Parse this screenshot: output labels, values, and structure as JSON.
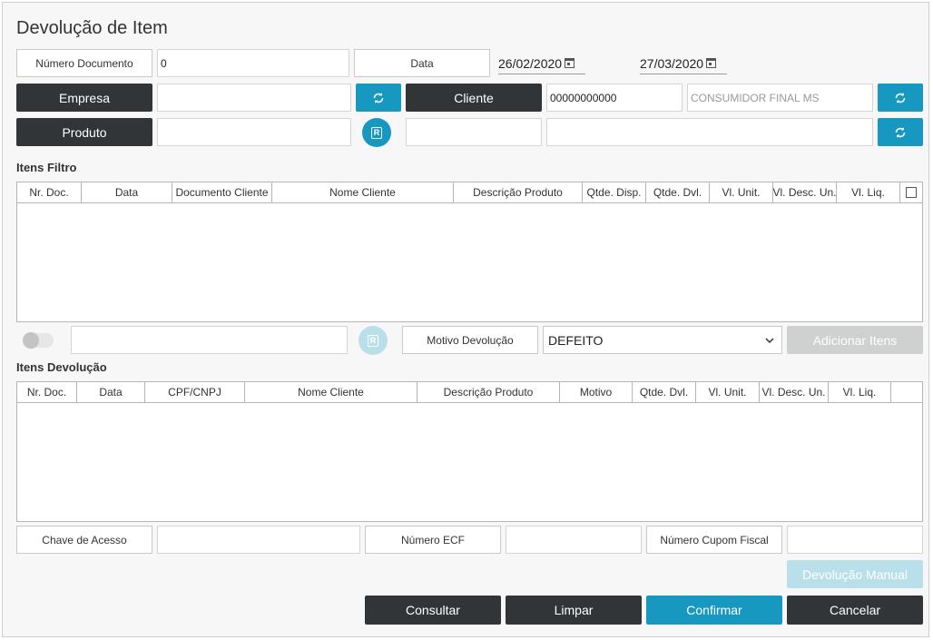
{
  "title": "Devolução de Item",
  "header": {
    "numero_documento_label": "Número Documento",
    "numero_documento_value": "0",
    "data_label": "Data",
    "date_from": "26/02/2020",
    "date_to": "27/03/2020",
    "empresa_label": "Empresa",
    "empresa_value": "",
    "cliente_label": "Cliente",
    "cliente_code": "00000000000",
    "cliente_name": "CONSUMIDOR FINAL MS",
    "produto_label": "Produto",
    "produto_value": "",
    "produto_code": "",
    "produto_desc": "",
    "r_badge": "R"
  },
  "itens_filtro": {
    "title": "Itens Filtro",
    "columns": [
      "Nr. Doc.",
      "Data",
      "Documento Cliente",
      "Nome Cliente",
      "Descrição Produto",
      "Qtde. Disp.",
      "Qtde. Dvl.",
      "Vl. Unit.",
      "Vl. Desc. Un.",
      "Vl. Liq."
    ],
    "rows": []
  },
  "mid": {
    "scan_value": "",
    "motivo_label": "Motivo Devolução",
    "motivo_value": "DEFEITO",
    "adicionar_label": "Adicionar Itens"
  },
  "itens_devolucao": {
    "title": "Itens Devolução",
    "columns": [
      "Nr. Doc.",
      "Data",
      "CPF/CNPJ",
      "Nome Cliente",
      "Descrição Produto",
      "Motivo",
      "Qtde. Dvl.",
      "Vl. Unit.",
      "Vl. Desc. Un.",
      "Vl. Liq."
    ],
    "rows": []
  },
  "bottom": {
    "chave_label": "Chave de Acesso",
    "chave_value": "",
    "ecf_label": "Número ECF",
    "ecf_value": "",
    "cupom_label": "Número Cupom Fiscal",
    "cupom_value": "",
    "devolucao_manual_label": "Devolução Manual"
  },
  "actions": {
    "consultar": "Consultar",
    "limpar": "Limpar",
    "confirmar": "Confirmar",
    "cancelar": "Cancelar"
  },
  "colors": {
    "dark_button": "#323537",
    "accent_blue": "#1798c1",
    "disabled_blue": "#b9dfea",
    "disabled_gray": "#cfd0d0"
  }
}
